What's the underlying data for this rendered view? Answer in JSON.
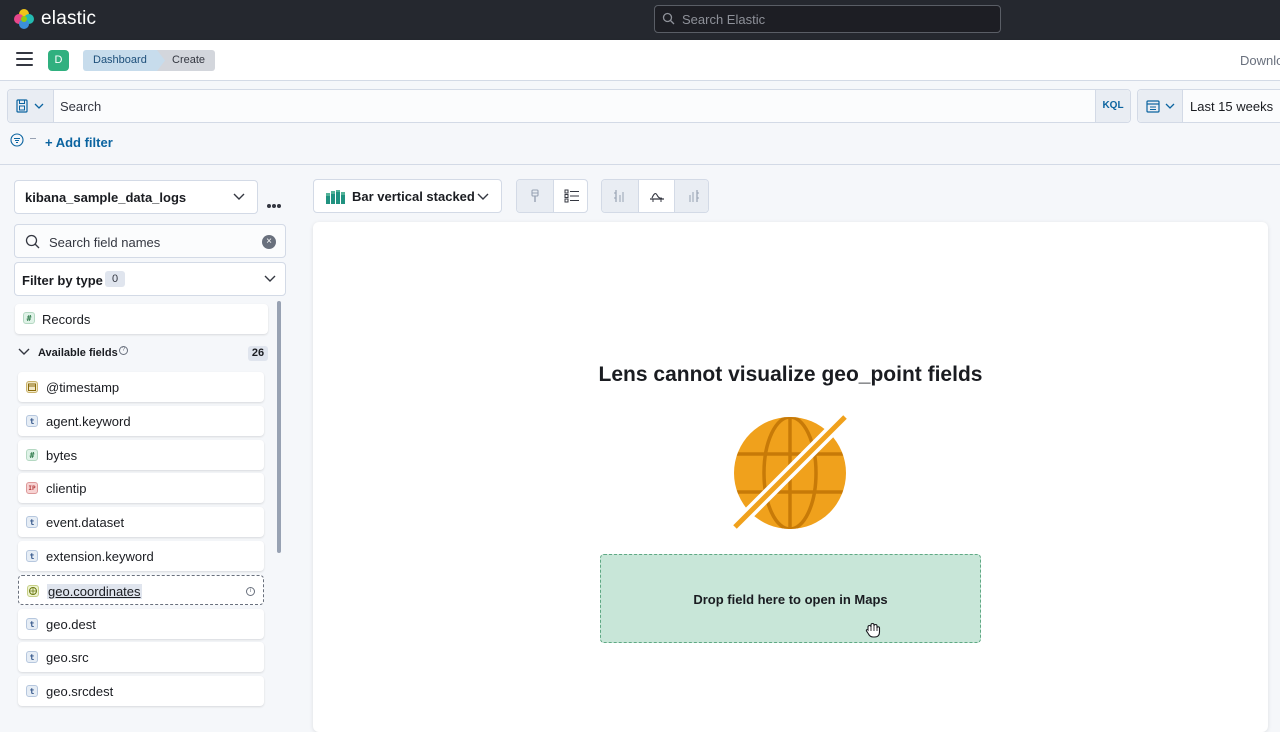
{
  "header": {
    "brand": "elastic",
    "search_placeholder": "Search Elastic"
  },
  "subheader": {
    "space_initial": "D",
    "breadcrumbs": [
      "Dashboard",
      "Create"
    ],
    "download_label": "Downlo"
  },
  "querybar": {
    "search_placeholder": "Search",
    "language_label": "KQL",
    "date_range": "Last 15 weeks",
    "add_filter_label": "+ Add filter"
  },
  "datasource": {
    "index_pattern": "kibana_sample_data_logs",
    "field_search_placeholder": "Search field names",
    "filter_by_type_label": "Filter by type",
    "filter_by_type_count": "0",
    "records_label": "Records",
    "available_fields_label": "Available fields",
    "available_fields_count": "26",
    "fields": [
      {
        "name": "@timestamp",
        "type": "date",
        "type_glyph": ""
      },
      {
        "name": "agent.keyword",
        "type": "string",
        "type_glyph": "t"
      },
      {
        "name": "bytes",
        "type": "number",
        "type_glyph": "#"
      },
      {
        "name": "clientip",
        "type": "ip",
        "type_glyph": "IP"
      },
      {
        "name": "event.dataset",
        "type": "string",
        "type_glyph": "t"
      },
      {
        "name": "extension.keyword",
        "type": "string",
        "type_glyph": "t"
      },
      {
        "name": "geo.coordinates",
        "type": "geo_point",
        "type_glyph": ""
      },
      {
        "name": "geo.dest",
        "type": "string",
        "type_glyph": "t"
      },
      {
        "name": "geo.src",
        "type": "string",
        "type_glyph": "t"
      },
      {
        "name": "geo.srcdest",
        "type": "string",
        "type_glyph": "t"
      }
    ]
  },
  "workspace": {
    "chart_type_label": "Bar vertical stacked",
    "message_title": "Lens cannot visualize geo_point fields",
    "dropzone_text": "Drop field here to open in Maps"
  },
  "colors": {
    "header_bg": "#25282f",
    "link": "#0b64a0",
    "dropzone_bg": "#c8e6d8",
    "globe": "#f0a11c"
  }
}
